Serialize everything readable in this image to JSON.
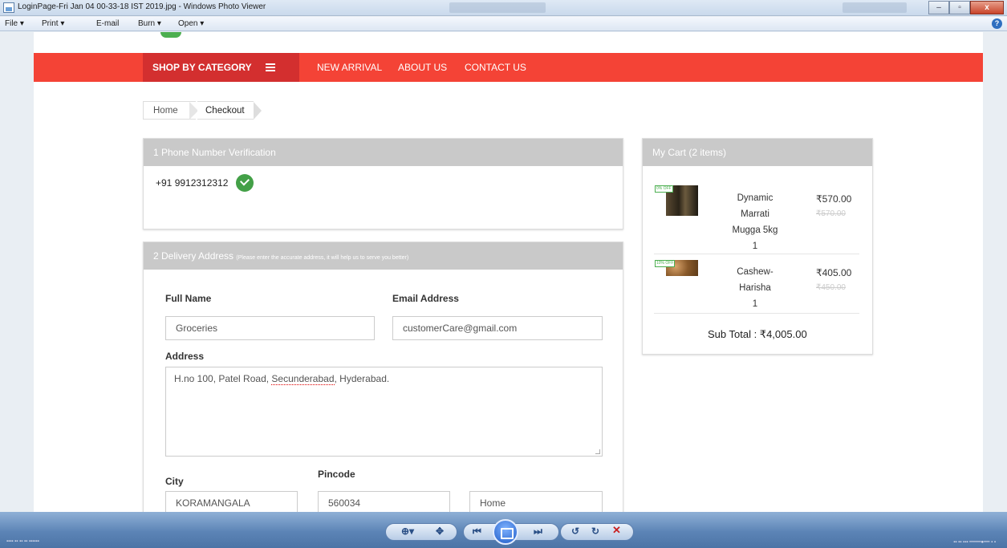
{
  "window": {
    "title": "LoginPage-Fri Jan 04 00-33-18 IST 2019.jpg - Windows Photo Viewer",
    "menu": [
      "File",
      "Print",
      "E-mail",
      "Burn",
      "Open"
    ]
  },
  "nav": {
    "category": "SHOP BY CATEGORY",
    "links": [
      "NEW ARRIVAL",
      "ABOUT US",
      "CONTACT US"
    ]
  },
  "breadcrumb": {
    "home": "Home",
    "current": "Checkout"
  },
  "phone_section": {
    "title": "1  Phone Number Verification",
    "phone": "+91 9912312312"
  },
  "delivery": {
    "title": "2  Delivery Address",
    "subtitle": "(Please enter the accurate address, it will help us to serve you better)",
    "full_name_label": "Full Name",
    "full_name_value": "Groceries",
    "email_label": "Email Address",
    "email_value": "customerCare@gmail.com",
    "address_label": "Address",
    "address_prefix": "H.no 100, Patel Road, ",
    "address_misspelled": "Secunderabad",
    "address_suffix": ", Hyderabad.",
    "city_label": "City",
    "city_value": "KORAMANGALA",
    "pincode_label": "Pincode",
    "pincode_value": "560034",
    "type_value": "Home"
  },
  "cart": {
    "title": "My Cart (2 items)",
    "items": [
      {
        "tag": "0% OFF",
        "name_lines": [
          "Dynamic",
          "Marrati",
          "Mugga 5kg"
        ],
        "qty": "1",
        "price": "₹570.00",
        "mrp": "₹570.00"
      },
      {
        "tag": "10% OFF",
        "name_lines": [
          "Cashew-",
          "Harisha"
        ],
        "qty": "1",
        "price": "₹405.00",
        "mrp": "₹450.00"
      }
    ],
    "subtotal": "Sub Total : ₹4,005.00"
  },
  "colors": {
    "nav_red": "#f44336",
    "nav_dark_red": "#d32f2f",
    "panel_header": "#c9c9c9",
    "verified_green": "#43a047"
  }
}
